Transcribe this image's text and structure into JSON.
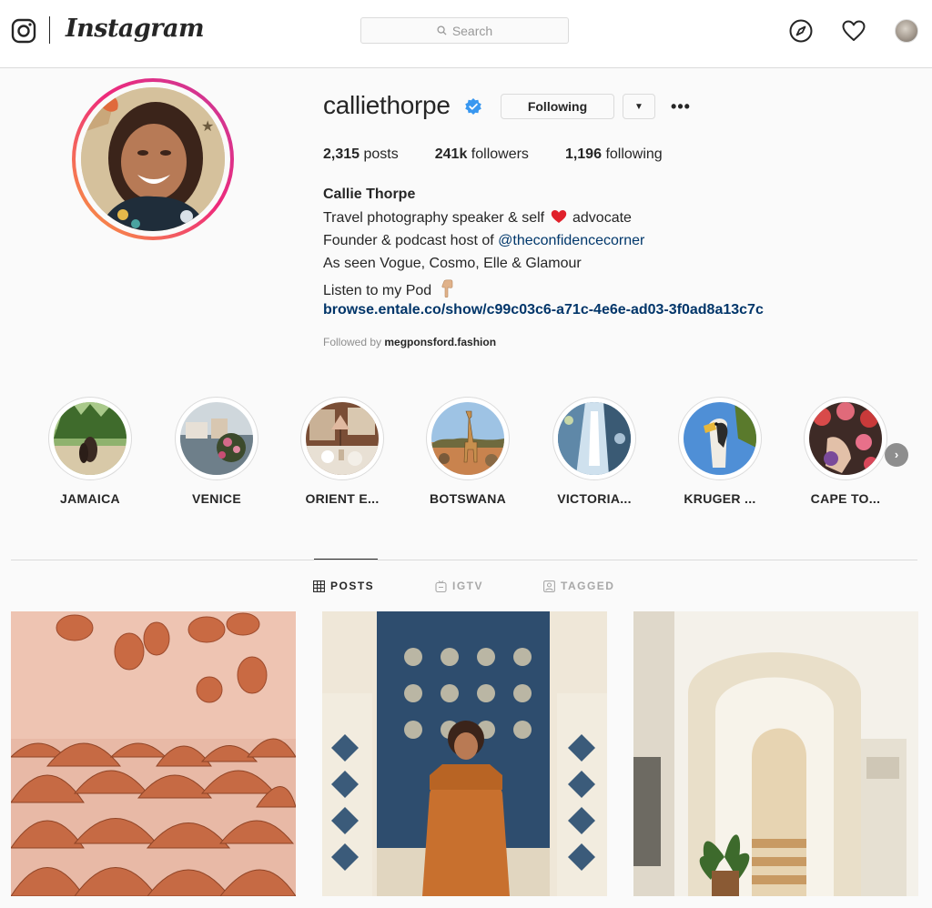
{
  "app": {
    "name": "Instagram"
  },
  "search": {
    "placeholder": "Search"
  },
  "profile": {
    "username": "calliethorpe",
    "follow_button": "Following",
    "dropdown_glyph": "▼",
    "more_glyph": "•••",
    "stats": {
      "posts_count": "2,315",
      "posts_label": "posts",
      "followers_count": "241k",
      "followers_label": "followers",
      "following_count": "1,196",
      "following_label": "following"
    },
    "full_name": "Callie Thorpe",
    "bio": {
      "line1_before": "Travel photography speaker & self",
      "line1_after": "advocate",
      "line2_before": "Founder & podcast host of",
      "line2_mention": "@theconfidencecorner",
      "line3": "As seen Vogue, Cosmo, Elle & Glamour",
      "line4": "Listen to my Pod",
      "link": "browse.entale.co/show/c99c03c6-a71c-4e6e-ad03-3f0ad8a13c7c"
    },
    "followed_by_prefix": "Followed by",
    "followed_by_user": "megponsford.fashion"
  },
  "highlights": [
    {
      "label": "JAMAICA"
    },
    {
      "label": "VENICE"
    },
    {
      "label": "ORIENT E..."
    },
    {
      "label": "BOTSWANA"
    },
    {
      "label": "VICTORIA..."
    },
    {
      "label": "KRUGER ..."
    },
    {
      "label": "CAPE TO..."
    }
  ],
  "highlights_next_glyph": "›",
  "tabs": [
    {
      "label": "POSTS",
      "active": true
    },
    {
      "label": "IGTV",
      "active": false
    },
    {
      "label": "TAGGED",
      "active": false
    }
  ],
  "icons": {
    "brand": "instagram-glyph-icon",
    "explore": "compass-icon",
    "activity": "heart-icon",
    "verified": "verified-badge-icon"
  },
  "colors": {
    "link": "#003569",
    "verified": "#3897f0",
    "story_ring_start": "#f9a33a",
    "story_ring_end": "#c73a9a",
    "border": "#dbdbdb"
  }
}
